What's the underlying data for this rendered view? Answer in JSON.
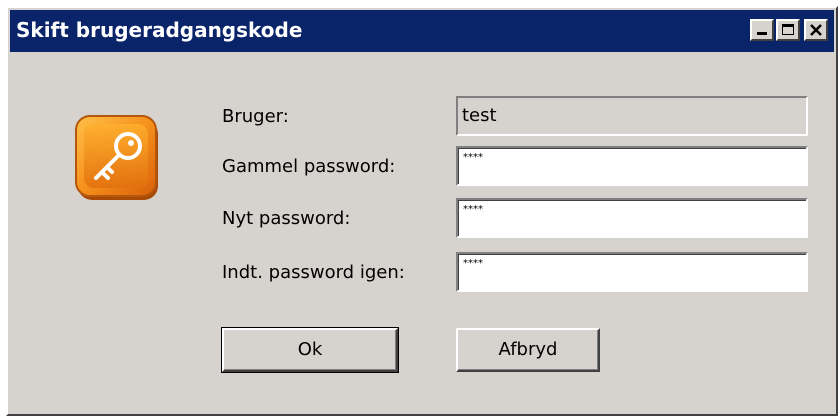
{
  "window": {
    "title": "Skift brugeradgangskode"
  },
  "titlebar_buttons": {
    "minimize": "minimize-icon",
    "maximize": "maximize-icon",
    "close": "close-icon"
  },
  "icon": {
    "name": "key-icon",
    "color": "#f28a1a"
  },
  "form": {
    "user_label": "Bruger:",
    "user_value": "test",
    "old_password_label": "Gammel password:",
    "old_password_value": "****",
    "new_password_label": "Nyt password:",
    "new_password_value": "****",
    "repeat_password_label": "Indt. password igen:",
    "repeat_password_value": "****"
  },
  "buttons": {
    "ok_label": "Ok",
    "cancel_label": "Afbryd"
  },
  "colors": {
    "titlebar": "#0a246a",
    "face": "#d6d3ce"
  }
}
